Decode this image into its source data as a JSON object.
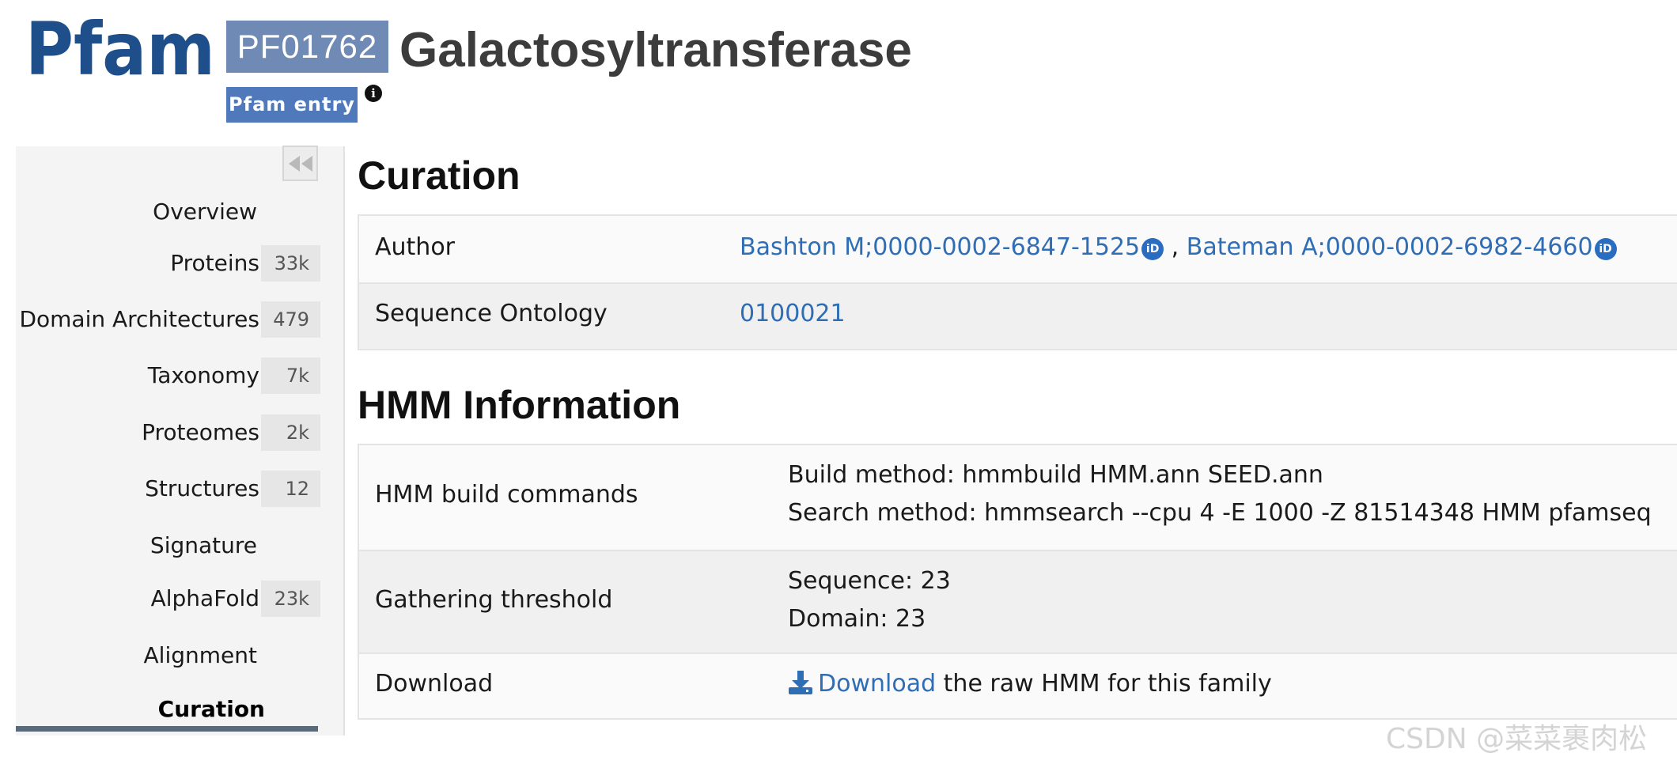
{
  "header": {
    "logo_text": "Pfam",
    "accession": "PF01762",
    "entry_type": "Pfam entry",
    "info_icon": "info-icon",
    "title": "Galactosyltransferase"
  },
  "sidebar": {
    "collapse_icon": "double-chevron-left-icon",
    "items": [
      {
        "label": "Overview",
        "count": null
      },
      {
        "label": "Proteins",
        "count": "33k"
      },
      {
        "label": "Domain Architectures",
        "count": "479"
      },
      {
        "label": "Taxonomy",
        "count": "7k"
      },
      {
        "label": "Proteomes",
        "count": "2k"
      },
      {
        "label": "Structures",
        "count": "12"
      },
      {
        "label": "Signature",
        "count": null
      },
      {
        "label": "AlphaFold",
        "count": "23k"
      },
      {
        "label": "Alignment",
        "count": null
      },
      {
        "label": "Curation",
        "count": null,
        "active": true
      }
    ]
  },
  "curation": {
    "title": "Curation",
    "author_label": "Author",
    "authors": [
      "Bashton M;0000-0002-6847-1525",
      "Bateman A;0000-0002-6982-4660"
    ],
    "author_separator": " , ",
    "orcid_icon_text": "iD",
    "so_label": "Sequence Ontology",
    "so_value": "0100021"
  },
  "hmm": {
    "title": "HMM Information",
    "build_label": "HMM build commands",
    "build_method": "Build method: hmmbuild HMM.ann SEED.ann",
    "search_method": "Search method: hmmsearch --cpu 4 -E 1000 -Z 81514348 HMM pfamseq",
    "gathering_label": "Gathering threshold",
    "gathering_sequence": "Sequence: 23",
    "gathering_domain": "Domain: 23",
    "download_label": "Download",
    "download_link": "Download",
    "download_suffix": " the raw HMM for this family",
    "download_icon": "download-icon"
  },
  "watermark": "CSDN @菜菜裹肉松",
  "colors": {
    "logo": "#1e4f8a",
    "accession_bg": "#6f8bb5",
    "entry_type_bg": "#4f79bb",
    "link": "#2f6db5",
    "active_bar": "#5a6a7a"
  }
}
